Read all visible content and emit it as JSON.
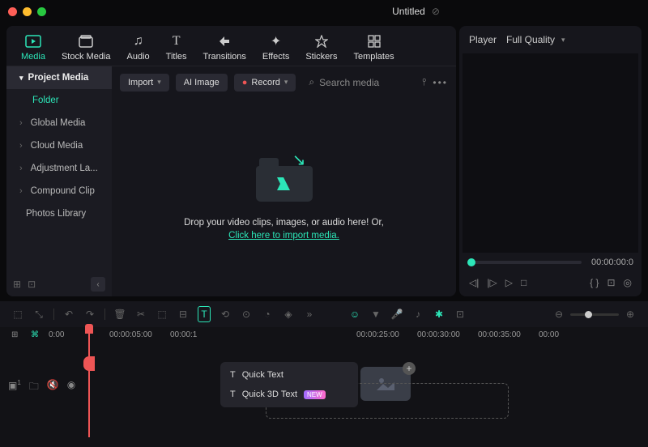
{
  "window": {
    "title": "Untitled"
  },
  "tabs": [
    {
      "id": "media",
      "label": "Media"
    },
    {
      "id": "stock",
      "label": "Stock Media"
    },
    {
      "id": "audio",
      "label": "Audio"
    },
    {
      "id": "titles",
      "label": "Titles"
    },
    {
      "id": "transitions",
      "label": "Transitions"
    },
    {
      "id": "effects",
      "label": "Effects"
    },
    {
      "id": "stickers",
      "label": "Stickers"
    },
    {
      "id": "templates",
      "label": "Templates"
    }
  ],
  "sidebar": {
    "group": "Project Media",
    "folder": "Folder",
    "items": [
      "Global Media",
      "Cloud Media",
      "Adjustment La...",
      "Compound Clip",
      "Photos Library"
    ]
  },
  "toolbar": {
    "import": "Import",
    "ai_image": "AI Image",
    "record": "Record",
    "search_placeholder": "Search media"
  },
  "dropzone": {
    "text": "Drop your video clips, images, or audio here! Or,",
    "link": "Click here to import media."
  },
  "preview": {
    "player_label": "Player",
    "quality": "Full Quality",
    "time": "00:00:00:0"
  },
  "timeline": {
    "marks": [
      "0:00",
      "00:00:05:00",
      "00:00:1",
      "00:00:25:00",
      "00:00:30:00",
      "00:00:35:00",
      "00:00"
    ],
    "dropdown": {
      "item1": "Quick Text",
      "item2": "Quick 3D Text",
      "badge": "NEW"
    }
  },
  "colors": {
    "accent": "#2ce6b8",
    "red": "#ff5f57",
    "yellow": "#febc2e",
    "green": "#28c840"
  }
}
